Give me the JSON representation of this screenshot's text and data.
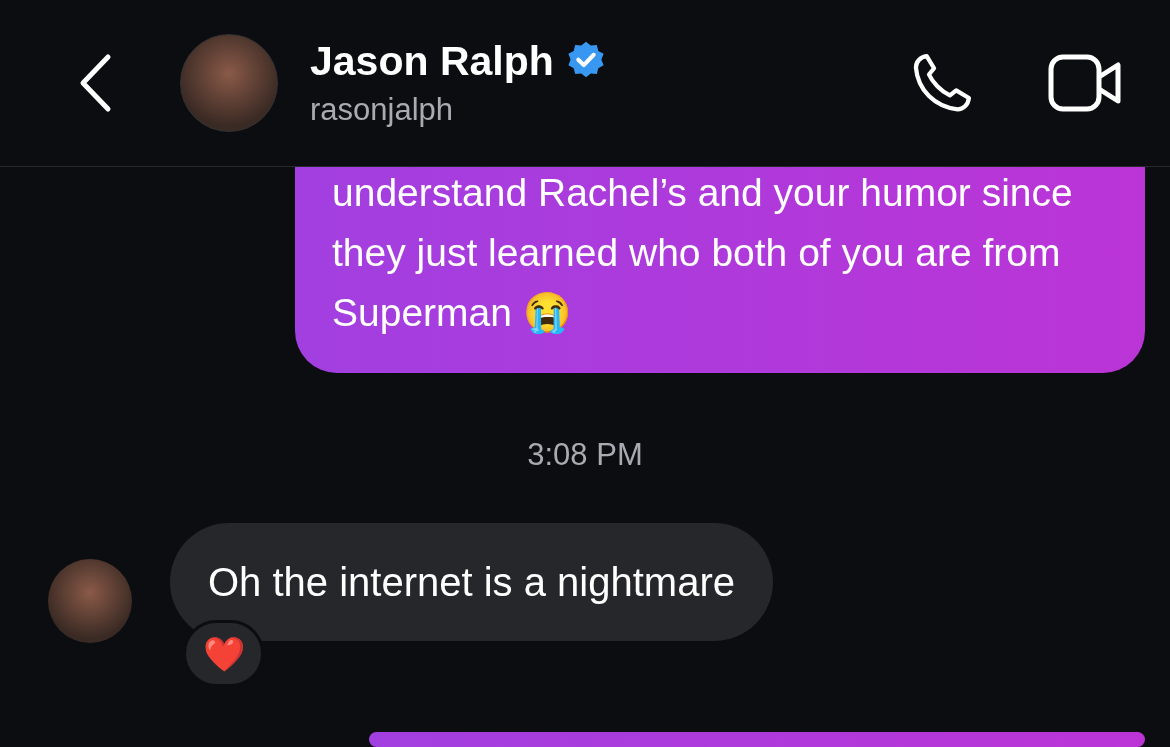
{
  "header": {
    "title": "Jason Ralph",
    "subtitle": "rasonjalph",
    "verified": true
  },
  "messages": [
    {
      "kind": "outgoing",
      "text": "understand Rachel’s and your humor since they just learned who both of you are from Superman 😭"
    },
    {
      "kind": "time",
      "text": "3:08 PM"
    },
    {
      "kind": "incoming",
      "text": "Oh the internet is a nightmare",
      "reaction": "❤️"
    },
    {
      "kind": "outgoing"
    }
  ]
}
